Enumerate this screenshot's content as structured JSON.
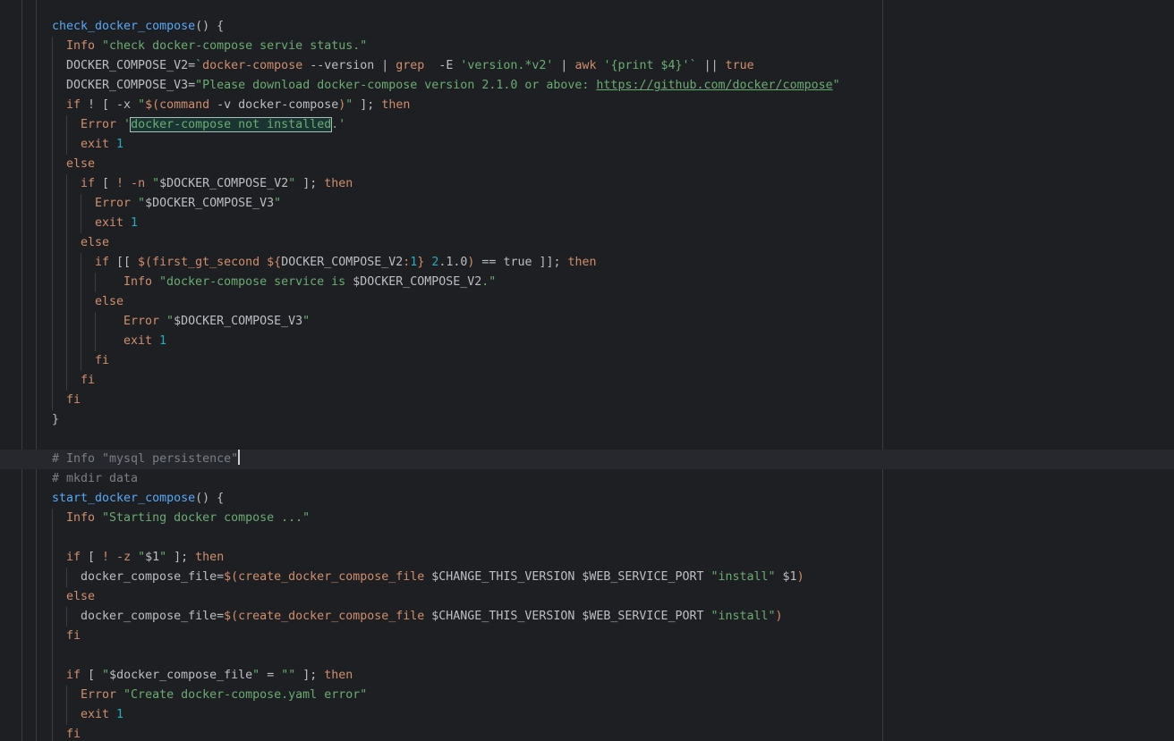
{
  "editor": {
    "language": "shell",
    "colors": {
      "background": "#1e1f22",
      "text": "#bcbec4",
      "function": "#56a8f5",
      "keyword": "#cf8e6d",
      "string": "#6aab73",
      "number": "#2aacb8",
      "comment": "#7a7e85"
    },
    "lines": [
      {
        "indent": 0,
        "guides": 0,
        "tokens": [
          {
            "t": "check_docker_compose",
            "c": "fn"
          },
          {
            "t": "() {",
            "c": "txt"
          }
        ]
      },
      {
        "indent": 1,
        "guides": 1,
        "tokens": [
          {
            "t": "Info ",
            "c": "kw"
          },
          {
            "t": "\"check docker-compose servie status.\"",
            "c": "str"
          }
        ]
      },
      {
        "indent": 1,
        "guides": 1,
        "tokens": [
          {
            "t": "DOCKER_COMPOSE_V2=",
            "c": "txt"
          },
          {
            "t": "`",
            "c": "str"
          },
          {
            "t": "docker-compose",
            "c": "kw"
          },
          {
            "t": " --version | ",
            "c": "txt"
          },
          {
            "t": "grep",
            "c": "kw"
          },
          {
            "t": "  -E ",
            "c": "txt"
          },
          {
            "t": "'version.*v2'",
            "c": "str"
          },
          {
            "t": " | ",
            "c": "txt"
          },
          {
            "t": "awk",
            "c": "kw"
          },
          {
            "t": " ",
            "c": "txt"
          },
          {
            "t": "'{print $4}'",
            "c": "str"
          },
          {
            "t": "`",
            "c": "str"
          },
          {
            "t": " || ",
            "c": "txt"
          },
          {
            "t": "true",
            "c": "kw"
          }
        ]
      },
      {
        "indent": 1,
        "guides": 1,
        "tokens": [
          {
            "t": "DOCKER_COMPOSE_V3=",
            "c": "txt"
          },
          {
            "t": "\"Please download docker-compose version 2.1.0 or above: ",
            "c": "str"
          },
          {
            "t": "https://github.com/docker/compose",
            "c": "link"
          },
          {
            "t": "\"",
            "c": "str"
          }
        ]
      },
      {
        "indent": 1,
        "guides": 1,
        "tokens": [
          {
            "t": "if",
            "c": "kw"
          },
          {
            "t": " ! [ -x ",
            "c": "txt"
          },
          {
            "t": "\"",
            "c": "str"
          },
          {
            "t": "$(",
            "c": "kw"
          },
          {
            "t": "command",
            "c": "kw"
          },
          {
            "t": " -v docker-compose",
            "c": "txt"
          },
          {
            "t": ")",
            "c": "kw"
          },
          {
            "t": "\"",
            "c": "str"
          },
          {
            "t": " ]; ",
            "c": "txt"
          },
          {
            "t": "then",
            "c": "kw"
          }
        ]
      },
      {
        "indent": 2,
        "guides": 2,
        "tokens": [
          {
            "t": "Error ",
            "c": "kw"
          },
          {
            "t": "'",
            "c": "str"
          },
          {
            "t": "docker-compose not installed",
            "c": "hl"
          },
          {
            "t": ".'",
            "c": "str"
          }
        ]
      },
      {
        "indent": 2,
        "guides": 2,
        "tokens": [
          {
            "t": "exit ",
            "c": "kw"
          },
          {
            "t": "1",
            "c": "num"
          }
        ]
      },
      {
        "indent": 1,
        "guides": 1,
        "tokens": [
          {
            "t": "else",
            "c": "kw"
          }
        ]
      },
      {
        "indent": 2,
        "guides": 2,
        "tokens": [
          {
            "t": "if",
            "c": "kw"
          },
          {
            "t": " [ ",
            "c": "txt"
          },
          {
            "t": "! -n",
            "c": "kw"
          },
          {
            "t": " ",
            "c": "txt"
          },
          {
            "t": "\"",
            "c": "str"
          },
          {
            "t": "$DOCKER_COMPOSE_V2",
            "c": "txt"
          },
          {
            "t": "\"",
            "c": "str"
          },
          {
            "t": " ]; ",
            "c": "txt"
          },
          {
            "t": "then",
            "c": "kw"
          }
        ]
      },
      {
        "indent": 3,
        "guides": 3,
        "tokens": [
          {
            "t": "Error ",
            "c": "kw"
          },
          {
            "t": "\"",
            "c": "str"
          },
          {
            "t": "$DOCKER_COMPOSE_V3",
            "c": "txt"
          },
          {
            "t": "\"",
            "c": "str"
          }
        ]
      },
      {
        "indent": 3,
        "guides": 3,
        "tokens": [
          {
            "t": "exit ",
            "c": "kw"
          },
          {
            "t": "1",
            "c": "num"
          }
        ]
      },
      {
        "indent": 2,
        "guides": 2,
        "tokens": [
          {
            "t": "else",
            "c": "kw"
          }
        ]
      },
      {
        "indent": 3,
        "guides": 3,
        "tokens": [
          {
            "t": "if",
            "c": "kw"
          },
          {
            "t": " [[ ",
            "c": "txt"
          },
          {
            "t": "$(",
            "c": "kw"
          },
          {
            "t": "first_gt_second",
            "c": "kw"
          },
          {
            "t": " ",
            "c": "txt"
          },
          {
            "t": "${",
            "c": "kw"
          },
          {
            "t": "DOCKER_COMPOSE_V2",
            "c": "txt"
          },
          {
            "t": ":",
            "c": "kw"
          },
          {
            "t": "1",
            "c": "num"
          },
          {
            "t": "}",
            "c": "kw"
          },
          {
            "t": " ",
            "c": "txt"
          },
          {
            "t": "2",
            "c": "num"
          },
          {
            "t": ".1.0",
            "c": "txt"
          },
          {
            "t": ")",
            "c": "kw"
          },
          {
            "t": " == ",
            "c": "txt"
          },
          {
            "t": "true",
            "c": "txt"
          },
          {
            "t": " ]]; ",
            "c": "txt"
          },
          {
            "t": "then",
            "c": "kw"
          }
        ]
      },
      {
        "indent": 5,
        "guides": 4,
        "tokens": [
          {
            "t": "Info ",
            "c": "kw"
          },
          {
            "t": "\"docker-compose service is ",
            "c": "str"
          },
          {
            "t": "$DOCKER_COMPOSE_V2",
            "c": "txt"
          },
          {
            "t": ".\"",
            "c": "str"
          }
        ]
      },
      {
        "indent": 3,
        "guides": 3,
        "tokens": [
          {
            "t": "else",
            "c": "kw"
          }
        ]
      },
      {
        "indent": 5,
        "guides": 4,
        "tokens": [
          {
            "t": "Error ",
            "c": "kw"
          },
          {
            "t": "\"",
            "c": "str"
          },
          {
            "t": "$DOCKER_COMPOSE_V3",
            "c": "txt"
          },
          {
            "t": "\"",
            "c": "str"
          }
        ]
      },
      {
        "indent": 5,
        "guides": 4,
        "tokens": [
          {
            "t": "exit ",
            "c": "kw"
          },
          {
            "t": "1",
            "c": "num"
          }
        ]
      },
      {
        "indent": 3,
        "guides": 3,
        "tokens": [
          {
            "t": "fi",
            "c": "kw"
          }
        ]
      },
      {
        "indent": 2,
        "guides": 2,
        "tokens": [
          {
            "t": "fi",
            "c": "kw"
          }
        ]
      },
      {
        "indent": 1,
        "guides": 1,
        "tokens": [
          {
            "t": "fi",
            "c": "kw"
          }
        ]
      },
      {
        "indent": 0,
        "guides": 0,
        "tokens": [
          {
            "t": "}",
            "c": "txt"
          }
        ]
      },
      {
        "indent": 0,
        "guides": 0,
        "tokens": []
      },
      {
        "indent": 0,
        "guides": 0,
        "caret": true,
        "tokens": [
          {
            "t": "# Info \"mysql persistence\"",
            "c": "cmt"
          }
        ]
      },
      {
        "indent": 0,
        "guides": 0,
        "tokens": [
          {
            "t": "# mkdir data",
            "c": "cmt"
          }
        ]
      },
      {
        "indent": 0,
        "guides": 0,
        "tokens": [
          {
            "t": "start_docker_compose",
            "c": "fn"
          },
          {
            "t": "() {",
            "c": "txt"
          }
        ]
      },
      {
        "indent": 1,
        "guides": 1,
        "tokens": [
          {
            "t": "Info ",
            "c": "kw"
          },
          {
            "t": "\"Starting docker compose ...\"",
            "c": "str"
          }
        ]
      },
      {
        "indent": 0,
        "guides": 1,
        "tokens": []
      },
      {
        "indent": 1,
        "guides": 1,
        "tokens": [
          {
            "t": "if",
            "c": "kw"
          },
          {
            "t": " [ ",
            "c": "txt"
          },
          {
            "t": "! -z",
            "c": "kw"
          },
          {
            "t": " ",
            "c": "txt"
          },
          {
            "t": "\"",
            "c": "str"
          },
          {
            "t": "$1",
            "c": "txt"
          },
          {
            "t": "\"",
            "c": "str"
          },
          {
            "t": " ]; ",
            "c": "txt"
          },
          {
            "t": "then",
            "c": "kw"
          }
        ]
      },
      {
        "indent": 2,
        "guides": 2,
        "tokens": [
          {
            "t": "docker_compose_file=",
            "c": "txt"
          },
          {
            "t": "$(",
            "c": "kw"
          },
          {
            "t": "create_docker_compose_file",
            "c": "kw"
          },
          {
            "t": " $CHANGE_THIS_VERSION $WEB_SERVICE_PORT ",
            "c": "txt"
          },
          {
            "t": "\"install\"",
            "c": "str"
          },
          {
            "t": " $1",
            "c": "txt"
          },
          {
            "t": ")",
            "c": "kw"
          }
        ]
      },
      {
        "indent": 1,
        "guides": 1,
        "tokens": [
          {
            "t": "else",
            "c": "kw"
          }
        ]
      },
      {
        "indent": 2,
        "guides": 2,
        "tokens": [
          {
            "t": "docker_compose_file=",
            "c": "txt"
          },
          {
            "t": "$(",
            "c": "kw"
          },
          {
            "t": "create_docker_compose_file",
            "c": "kw"
          },
          {
            "t": " $CHANGE_THIS_VERSION $WEB_SERVICE_PORT ",
            "c": "txt"
          },
          {
            "t": "\"install\"",
            "c": "str"
          },
          {
            "t": ")",
            "c": "kw"
          }
        ]
      },
      {
        "indent": 1,
        "guides": 1,
        "tokens": [
          {
            "t": "fi",
            "c": "kw"
          }
        ]
      },
      {
        "indent": 0,
        "guides": 1,
        "tokens": []
      },
      {
        "indent": 1,
        "guides": 1,
        "tokens": [
          {
            "t": "if",
            "c": "kw"
          },
          {
            "t": " [ ",
            "c": "txt"
          },
          {
            "t": "\"",
            "c": "str"
          },
          {
            "t": "$docker_compose_file",
            "c": "txt"
          },
          {
            "t": "\"",
            "c": "str"
          },
          {
            "t": " = ",
            "c": "txt"
          },
          {
            "t": "\"\"",
            "c": "str"
          },
          {
            "t": " ]; ",
            "c": "txt"
          },
          {
            "t": "then",
            "c": "kw"
          }
        ]
      },
      {
        "indent": 2,
        "guides": 2,
        "tokens": [
          {
            "t": "Error ",
            "c": "kw"
          },
          {
            "t": "\"Create docker-compose.yaml error\"",
            "c": "str"
          }
        ]
      },
      {
        "indent": 2,
        "guides": 2,
        "tokens": [
          {
            "t": "exit ",
            "c": "kw"
          },
          {
            "t": "1",
            "c": "num"
          }
        ]
      },
      {
        "indent": 1,
        "guides": 1,
        "tokens": [
          {
            "t": "fi",
            "c": "kw"
          }
        ]
      }
    ]
  }
}
